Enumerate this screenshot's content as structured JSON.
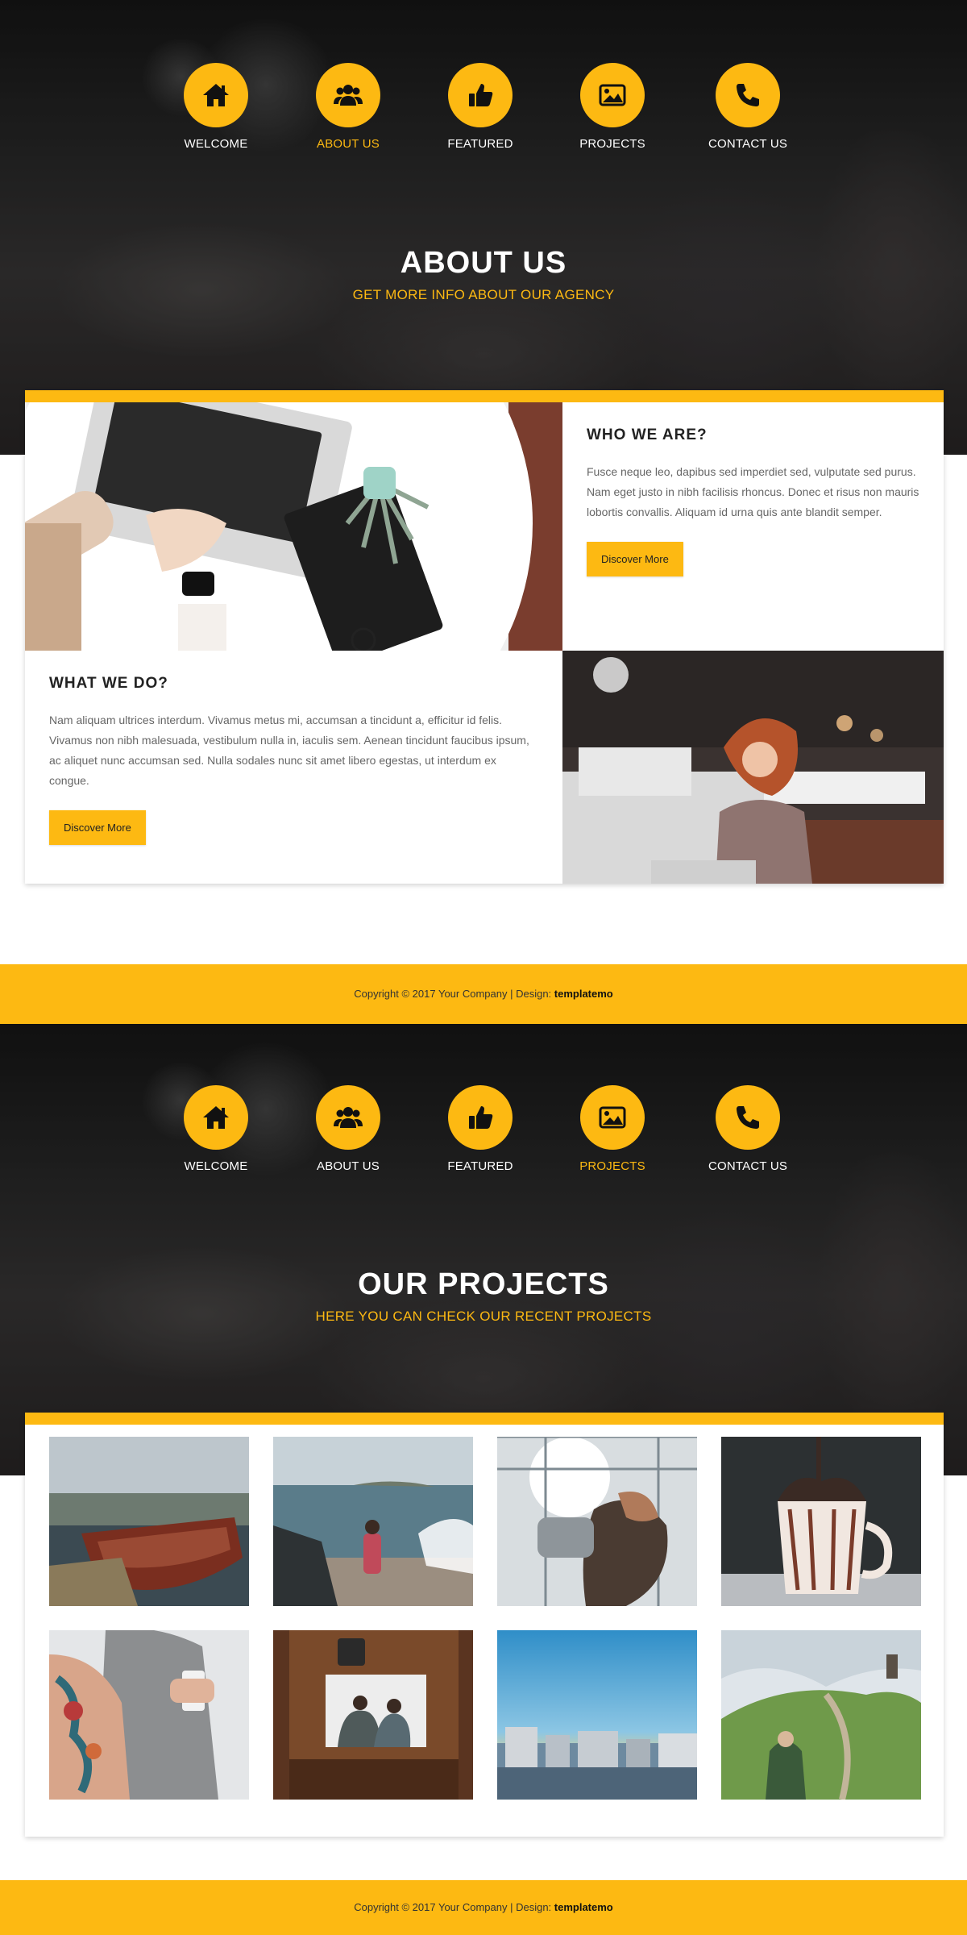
{
  "nav": {
    "items": [
      {
        "label": "WELCOME",
        "icon": "home-icon"
      },
      {
        "label": "ABOUT US",
        "icon": "users-icon"
      },
      {
        "label": "FEATURED",
        "icon": "thumbs-up-icon"
      },
      {
        "label": "PROJECTS",
        "icon": "image-icon"
      },
      {
        "label": "CONTACT US",
        "icon": "phone-icon"
      }
    ],
    "active_first": "ABOUT US",
    "active_second": "PROJECTS"
  },
  "about": {
    "title": "ABOUT US",
    "subtitle": "GET MORE INFO ABOUT OUR AGENCY",
    "who": {
      "title": "WHO WE ARE?",
      "text": "Fusce neque leo, dapibus sed imperdiet sed, vulputate sed purus. Nam eget justo in nibh facilisis rhoncus. Donec et risus non mauris lobortis convallis. Aliquam id urna quis ante blandit semper.",
      "button": "Discover More"
    },
    "what": {
      "title": "WHAT WE DO?",
      "text": "Nam aliquam ultrices interdum. Vivamus metus mi, accumsan a tincidunt a, efficitur id felis. Vivamus non nibh malesuada, vestibulum nulla in, iaculis sem. Aenean tincidunt faucibus ipsum, ac aliquet nunc accumsan sed. Nulla sodales nunc sit amet libero egestas, ut interdum ex congue.",
      "button": "Discover More"
    }
  },
  "projects": {
    "title": "OUR PROJECTS",
    "subtitle": "HERE YOU CAN CHECK OUR RECENT PROJECTS"
  },
  "footer": {
    "text": "Copyright © 2017 Your Company | Design: ",
    "brand": "templatemo"
  },
  "colors": {
    "accent": "#fdb912",
    "dark": "#222222"
  }
}
